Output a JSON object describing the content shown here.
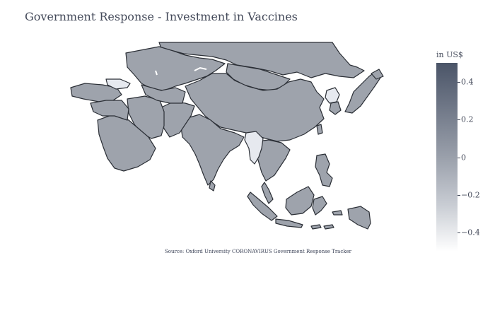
{
  "title": "Government Response - Investment in Vaccines",
  "source": "Source:  Oxford University CORONAVIRUS Government Response Tracker",
  "colorbar": {
    "title": "in US$",
    "ticks": [
      {
        "value": 0.4,
        "label": "0.4"
      },
      {
        "value": 0.2,
        "label": "0.2"
      },
      {
        "value": 0,
        "label": "0"
      },
      {
        "value": -0.2,
        "label": "−0.2"
      },
      {
        "value": -0.4,
        "label": "−0.4"
      }
    ],
    "range": [
      -0.5,
      0.5
    ],
    "colors": {
      "high": "#4b5568",
      "mid": "#9aa0ab",
      "low": "#ffffff"
    }
  },
  "chart_data": {
    "type": "choropleth",
    "region": "Asia",
    "colorscale_colors": {
      "default_country": "#9ea3ac",
      "low_value_country": "#e6e9ef",
      "border": "#2b2f36"
    },
    "regions": [
      {
        "name": "Kazakhstan",
        "value": 0
      },
      {
        "name": "Russia",
        "value": 0
      },
      {
        "name": "Mongolia",
        "value": 0
      },
      {
        "name": "China",
        "value": 0
      },
      {
        "name": "India",
        "value": 0
      },
      {
        "name": "Iran",
        "value": 0
      },
      {
        "name": "Saudi Arabia",
        "value": 0
      },
      {
        "name": "Turkey",
        "value": 0
      },
      {
        "name": "Georgia",
        "value": -0.5
      },
      {
        "name": "North Korea",
        "value": -0.5
      },
      {
        "name": "Myanmar",
        "value": -0.5
      },
      {
        "name": "Japan",
        "value": 0
      },
      {
        "name": "South Korea",
        "value": 0
      },
      {
        "name": "Indonesia",
        "value": 0
      },
      {
        "name": "Philippines",
        "value": 0
      },
      {
        "name": "Papua New Guinea",
        "value": 0
      }
    ]
  }
}
